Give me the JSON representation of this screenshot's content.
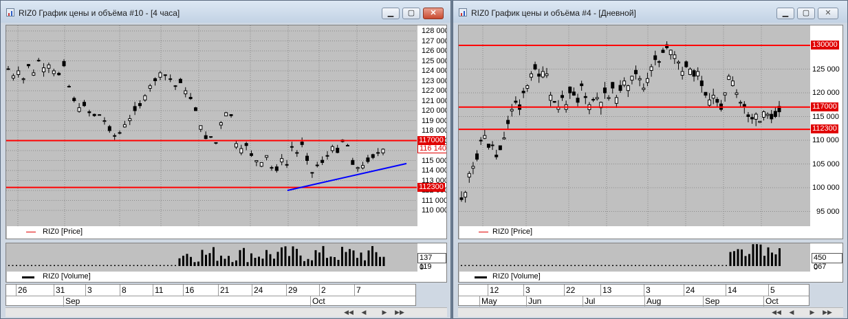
{
  "windows": [
    {
      "title": "RIZ0 График цены и объёма #10 - [4 часа]",
      "price_axis": [
        "128 000",
        "127 000",
        "126 000",
        "125 000",
        "124 000",
        "123 000",
        "122 000",
        "121 000",
        "120 000",
        "119 000",
        "118 000",
        "117 000",
        "116 000",
        "115 000",
        "114 000",
        "113 000",
        "112 000",
        "111 000",
        "110 000"
      ],
      "price_tags": [
        "117000",
        "116 140",
        "112300"
      ],
      "price_legend": "RIZ0 [Price]",
      "volume_tag": "137 119",
      "volume_zero": "0",
      "volume_legend": "RIZ0 [Volume]",
      "dates": [
        "26",
        "31",
        "3",
        "8",
        "11",
        "16",
        "21",
        "24",
        "29",
        "2",
        "7"
      ],
      "months": [
        "Sep",
        "Oct"
      ],
      "support_levels": [
        117000,
        112300
      ],
      "last_price": 116140,
      "colors": {
        "level_line": "#ff0000",
        "trend_line": "#0000ff",
        "candle": "#000000",
        "panel": "#c0c0c0"
      }
    },
    {
      "title": "RIZ0 График цены и объёма #4 - [Дневной]",
      "price_axis": [
        "130 000",
        "125 000",
        "120 000",
        "115 000",
        "110 000",
        "105 000",
        "100 000",
        "95 000"
      ],
      "price_tags": [
        "130000",
        "117000",
        "112300"
      ],
      "price_legend": "RIZ0 [Price]",
      "volume_tag": "450 067",
      "volume_zero": "0",
      "volume_legend": "RIZ0 [Volume]",
      "dates": [
        "12",
        "3",
        "22",
        "13",
        "3",
        "24",
        "14",
        "5"
      ],
      "months": [
        "May",
        "Jun",
        "Jul",
        "Aug",
        "Sep",
        "Oct"
      ],
      "resistance_levels": [
        130000,
        117000,
        112300
      ]
    }
  ]
}
